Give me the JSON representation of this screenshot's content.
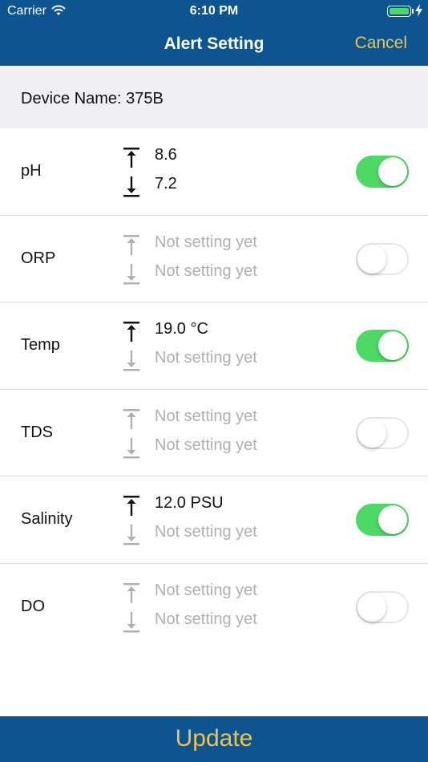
{
  "status_bar": {
    "carrier": "Carrier",
    "time": "6:10 PM"
  },
  "nav": {
    "title": "Alert Setting",
    "cancel_label": "Cancel"
  },
  "device": {
    "label": "Device Name: 375B"
  },
  "sensors": [
    {
      "name": "pH",
      "upper": "8.6",
      "lower": "7.2",
      "upper_set": true,
      "lower_set": true,
      "enabled": true
    },
    {
      "name": "ORP",
      "upper": "Not setting yet",
      "lower": "Not setting yet",
      "upper_set": false,
      "lower_set": false,
      "enabled": false
    },
    {
      "name": "Temp",
      "upper": "19.0 °C",
      "lower": "Not setting yet",
      "upper_set": true,
      "lower_set": false,
      "enabled": true
    },
    {
      "name": "TDS",
      "upper": "Not setting yet",
      "lower": "Not setting yet",
      "upper_set": false,
      "lower_set": false,
      "enabled": false
    },
    {
      "name": "Salinity",
      "upper": "12.0 PSU",
      "lower": "Not setting yet",
      "upper_set": true,
      "lower_set": false,
      "enabled": true
    },
    {
      "name": "DO",
      "upper": "Not setting yet",
      "lower": "Not setting yet",
      "upper_set": false,
      "lower_set": false,
      "enabled": false
    }
  ],
  "footer": {
    "update_label": "Update"
  },
  "colors": {
    "nav_bar": "#0d5590",
    "accent": "#f4c144",
    "toggle_on": "#4cd964",
    "unset_text": "#b0b0b0"
  }
}
